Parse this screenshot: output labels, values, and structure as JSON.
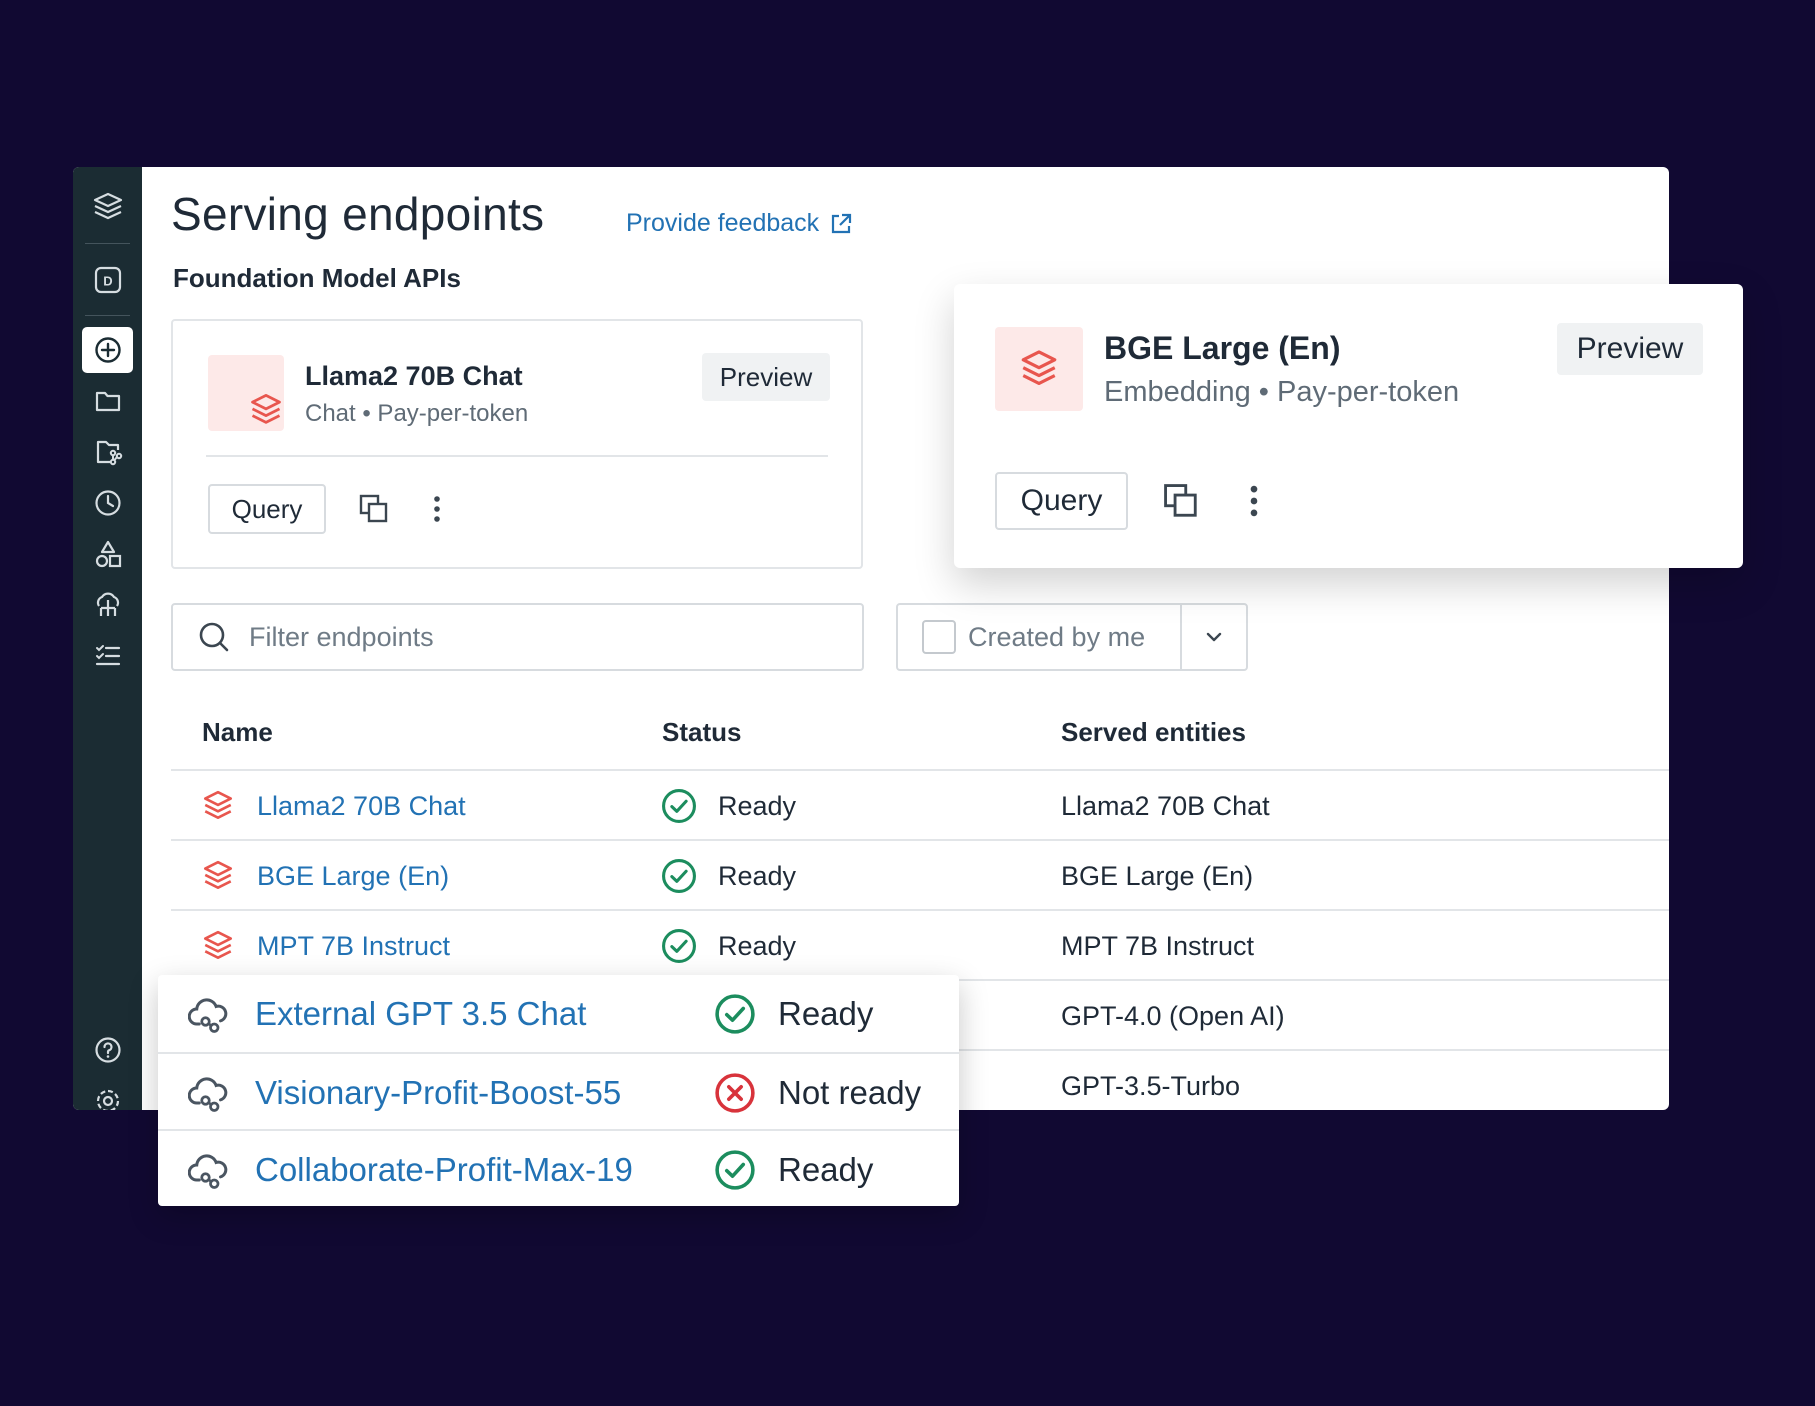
{
  "page": {
    "title": "Serving endpoints",
    "feedback_link": "Provide feedback",
    "section_title": "Foundation Model APIs"
  },
  "sidebar": {
    "items": [
      {
        "icon": "layers-logo-icon"
      },
      {
        "icon": "workspace-d-icon"
      },
      {
        "icon": "add-circle-icon",
        "active": true
      },
      {
        "icon": "folder-icon"
      },
      {
        "icon": "repo-icon"
      },
      {
        "icon": "clock-icon"
      },
      {
        "icon": "shapes-icon"
      },
      {
        "icon": "cloud-network-icon"
      },
      {
        "icon": "checklist-icon"
      },
      {
        "icon": "help-icon"
      },
      {
        "icon": "settings-icon"
      },
      {
        "icon": "user-icon"
      },
      {
        "icon": "sidebar-toggle-icon"
      }
    ]
  },
  "model_cards": [
    {
      "name": "Llama2 70B Chat",
      "subtitle": "Chat • Pay-per-token",
      "badge": "Preview",
      "query_label": "Query"
    },
    {
      "name": "BGE Large (En)",
      "subtitle": "Embedding • Pay-per-token",
      "badge": "Preview",
      "query_label": "Query"
    }
  ],
  "filters": {
    "search_placeholder": "Filter endpoints",
    "created_by_me": "Created by me"
  },
  "table": {
    "columns": [
      "Name",
      "Status",
      "Served entities"
    ],
    "rows": [
      {
        "name": "Llama2 70B Chat",
        "status": "Ready",
        "entity": "Llama2 70B Chat"
      },
      {
        "name": "BGE Large (En)",
        "status": "Ready",
        "entity": "BGE Large (En)"
      },
      {
        "name": "MPT 7B Instruct",
        "status": "Ready",
        "entity": "MPT 7B Instruct"
      },
      {
        "name": "",
        "status": "",
        "entity": "GPT-4.0 (Open AI)"
      },
      {
        "name": "",
        "status": "",
        "entity": "GPT-3.5-Turbo"
      }
    ]
  },
  "external_endpoints": [
    {
      "name": "External GPT 3.5 Chat",
      "status": "Ready"
    },
    {
      "name": "Visionary-Profit-Boost-55",
      "status": "Not ready"
    },
    {
      "name": "Collaborate-Profit-Max-19",
      "status": "Ready"
    }
  ],
  "colors": {
    "background": "#110932",
    "sidebar": "#1b2c33",
    "link": "#2272b4",
    "ready": "#1c8d5e",
    "not_ready": "#d8333b",
    "model_icon": "#e8564e"
  }
}
